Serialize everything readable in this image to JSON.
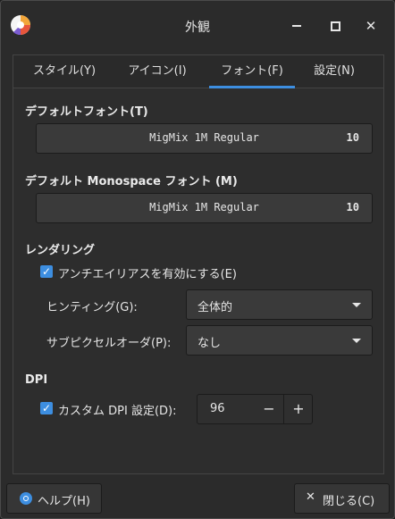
{
  "window": {
    "title": "外観"
  },
  "tabs": [
    {
      "label": "スタイル(Y)"
    },
    {
      "label": "アイコン(I)"
    },
    {
      "label": "フォント(F)",
      "active": true
    },
    {
      "label": "設定(N)"
    }
  ],
  "default_font": {
    "label": "デフォルトフォント(T)",
    "name": "MigMix 1M Regular",
    "size": "10"
  },
  "mono_font": {
    "label": "デフォルト Monospace フォント (M)",
    "name": "MigMix 1M Regular",
    "size": "10"
  },
  "rendering": {
    "label": "レンダリング",
    "antialias": {
      "label": "アンチエイリアスを有効にする(E)",
      "checked": true
    },
    "hinting": {
      "label": "ヒンティング(G):",
      "value": "全体的"
    },
    "subpixel": {
      "label": "サブピクセルオーダ(P):",
      "value": "なし"
    }
  },
  "dpi": {
    "label": "DPI",
    "custom": {
      "label": "カスタム DPI 設定(D):",
      "checked": true,
      "value": "96"
    }
  },
  "buttons": {
    "help": "ヘルプ(H)",
    "close": "閉じる(C)"
  },
  "colors": {
    "accent": "#3d8ee0",
    "background": "#2b2b2b",
    "widget": "#3a3a3a"
  },
  "icons": [
    "app-icon",
    "minimize-icon",
    "maximize-icon",
    "close-icon",
    "check-icon",
    "chevron-down-icon",
    "minus-icon",
    "plus-icon",
    "help-icon"
  ]
}
